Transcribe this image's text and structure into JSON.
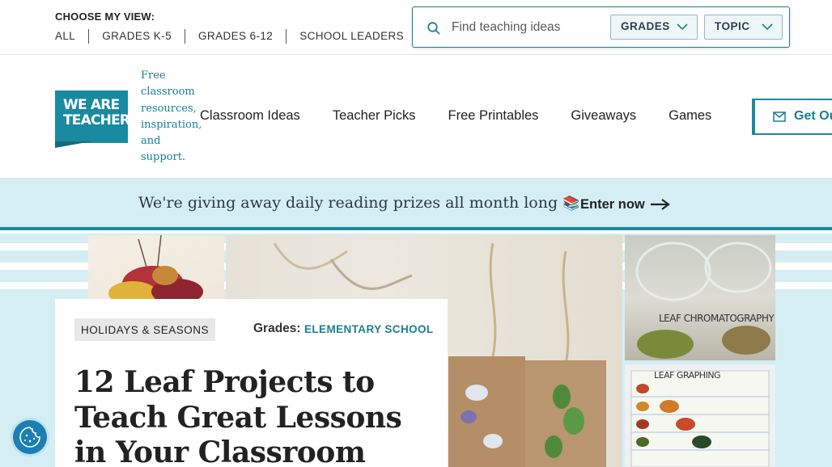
{
  "topbar": {
    "view_title": "CHOOSE MY VIEW:",
    "views": [
      "ALL",
      "GRADES K-5",
      "GRADES 6-12",
      "SCHOOL LEADERS"
    ],
    "search": {
      "placeholder": "Find teaching ideas",
      "icon": "search-icon",
      "grades_label": "GRADES",
      "topic_label": "TOPIC"
    }
  },
  "header": {
    "logo_line1": "WE ARE",
    "logo_line2": "TEACHERS",
    "tagline": "Free classroom resources, inspiration, and support.",
    "nav": [
      "Classroom Ideas",
      "Teacher Picks",
      "Free Printables",
      "Giveaways",
      "Games"
    ],
    "cta_label": "Get Our",
    "cta_icon": "envelope-icon"
  },
  "promo": {
    "text": "We're giving away daily reading prizes all month long",
    "emoji": "📚",
    "link_label": "Enter now"
  },
  "article": {
    "category": "HOLIDAYS & SEASONS",
    "grades_label": "Grades:",
    "grades_value": "ELEMENTARY SCHOOL",
    "title": "12 Leaf Projects to Teach Great Lessons in Your Classroom"
  },
  "photos": {
    "chromatography_caption": "LEAF CHROMATOGRAPHY",
    "graphing_caption": "LEAF GRAPHING"
  },
  "colors": {
    "brand_teal": "#1a8aa0",
    "promo_bg": "#d5eef3",
    "link_teal": "#1a7f91"
  },
  "cookie": {
    "icon": "cookie-icon"
  }
}
